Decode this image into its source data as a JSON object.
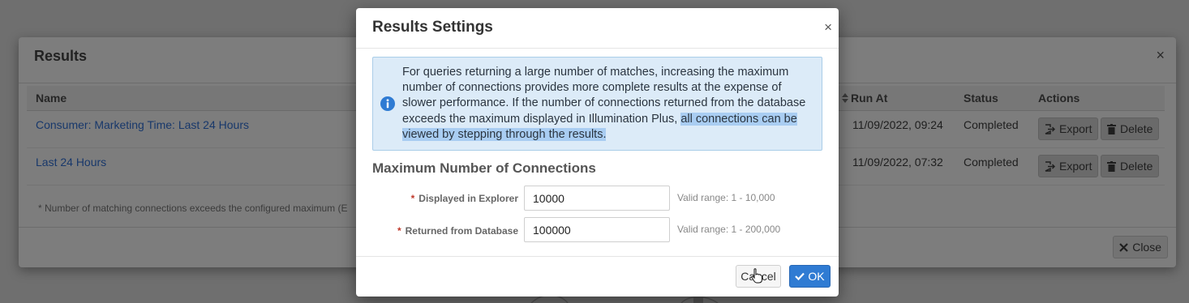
{
  "results_dialog": {
    "title": "Results",
    "close_symbol": "×",
    "columns": {
      "name": "Name",
      "run_at": "Run At",
      "status": "Status",
      "actions": "Actions"
    },
    "rows": [
      {
        "name": "Consumer: Marketing Time: Last 24 Hours",
        "run_at": "11/09/2022, 09:24",
        "status": "Completed"
      },
      {
        "name": "Last 24 Hours",
        "run_at": "11/09/2022, 07:32",
        "status": "Completed"
      }
    ],
    "export_label": "Export",
    "delete_label": "Delete",
    "footnote": "* Number of matching connections exceeds the configured maximum  (E",
    "close_label": "Close"
  },
  "settings_dialog": {
    "title": "Results Settings",
    "close_symbol": "×",
    "info_text_plain": "For queries returning a large number of matches, increasing the maximum number of connections provides more complete results at the expense of slower performance. If the number of connections returned from the database exceeds the maximum displayed in Illumination Plus, ",
    "info_text_selected": "all connections can be viewed by stepping through the results.",
    "section_title": "Maximum Number of Connections",
    "fields": [
      {
        "label": "Displayed in Explorer",
        "value": "10000",
        "hint": "Valid range: 1 - 10,000"
      },
      {
        "label": "Returned from Database",
        "value": "100000",
        "hint": "Valid range: 1 - 200,000"
      }
    ],
    "required_marker": "*",
    "cancel_label": "Cancel",
    "ok_label": "OK"
  },
  "icons": {
    "info": "info-circle-icon",
    "export": "export-icon",
    "delete": "trash-icon",
    "close": "times-icon",
    "ok": "check-icon",
    "sort": "sort-icon",
    "cursor": "hand-pointer-icon"
  },
  "colors": {
    "primary": "#2f7bd3",
    "info_bg": "#dcebf8",
    "selection": "#a9cdf2",
    "required": "#c0392b",
    "overlay": "#6f6f6f"
  }
}
